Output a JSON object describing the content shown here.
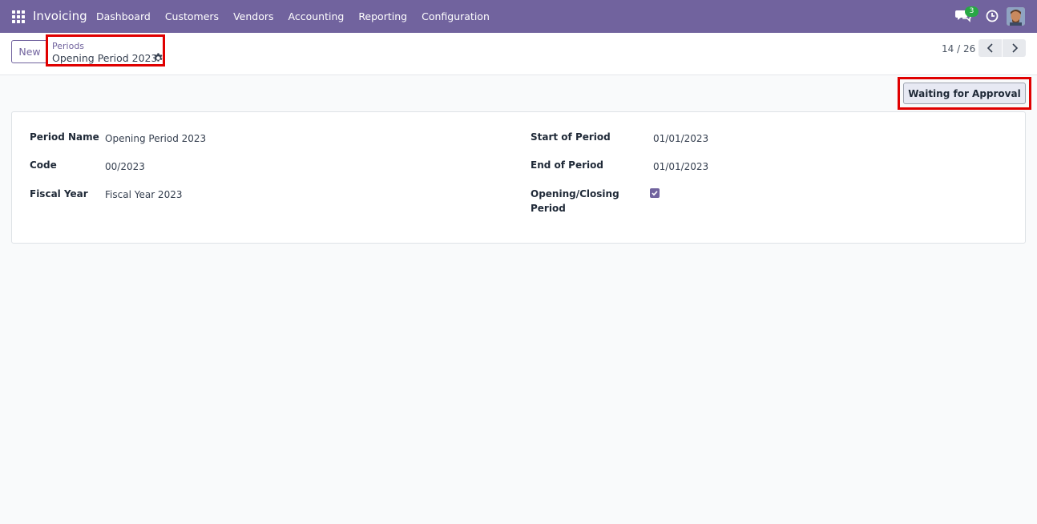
{
  "navbar": {
    "brand": "Invoicing",
    "menu": [
      "Dashboard",
      "Customers",
      "Vendors",
      "Accounting",
      "Reporting",
      "Configuration"
    ],
    "chat_count": "3",
    "bg_color": "#71639e"
  },
  "control_panel": {
    "new_label": "New",
    "breadcrumb_parent": "Periods",
    "breadcrumb_current": "Opening Period 2023",
    "pager": "14 / 26"
  },
  "status": {
    "button_label": "Waiting for Approval"
  },
  "form": {
    "left": [
      {
        "label": "Period Name",
        "value": "Opening Period 2023"
      },
      {
        "label": "Code",
        "value": "00/2023"
      },
      {
        "label": "Fiscal Year",
        "value": "Fiscal Year 2023"
      }
    ],
    "right": [
      {
        "label": "Start of Period",
        "value": "01/01/2023"
      },
      {
        "label": "End of Period",
        "value": "01/01/2023"
      }
    ],
    "opening_closing_label_line1": "Opening/Closing",
    "opening_closing_label_line2": "Period",
    "opening_closing_checked": true
  },
  "icons": {
    "apps": "apps-grid-icon",
    "chat": "chat-icon",
    "clock": "clock-icon",
    "gear": "gear-icon",
    "prev": "chevron-left-icon",
    "next": "chevron-right-icon",
    "check": "check-icon"
  }
}
